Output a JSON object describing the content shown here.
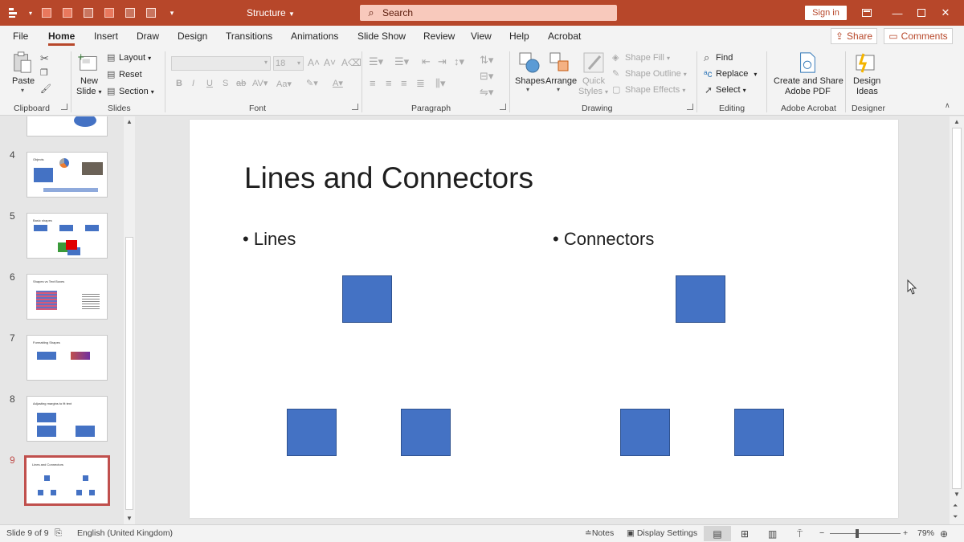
{
  "window": {
    "doc_title": "Structure",
    "search_placeholder": "Search",
    "sign_in": "Sign in"
  },
  "tabs": [
    "File",
    "Home",
    "Insert",
    "Draw",
    "Design",
    "Transitions",
    "Animations",
    "Slide Show",
    "Review",
    "View",
    "Help",
    "Acrobat"
  ],
  "active_tab": "Home",
  "actions": {
    "share": "Share",
    "comments": "Comments"
  },
  "ribbon": {
    "clipboard": {
      "paste": "Paste",
      "label": "Clipboard"
    },
    "slides": {
      "new_slide_1": "New",
      "new_slide_2": "Slide",
      "layout": "Layout",
      "reset": "Reset",
      "section": "Section",
      "label": "Slides"
    },
    "font": {
      "size": "18",
      "label": "Font"
    },
    "paragraph": {
      "label": "Paragraph"
    },
    "drawing": {
      "shapes": "Shapes",
      "arrange": "Arrange",
      "quick_styles_1": "Quick",
      "quick_styles_2": "Styles",
      "shape_fill": "Shape Fill",
      "shape_outline": "Shape Outline",
      "shape_effects": "Shape Effects",
      "label": "Drawing"
    },
    "editing": {
      "find": "Find",
      "replace": "Replace",
      "select": "Select",
      "label": "Editing"
    },
    "acrobat": {
      "create_1": "Create and Share",
      "create_2": "Adobe PDF",
      "label": "Adobe Acrobat"
    },
    "designer": {
      "ideas_1": "Design",
      "ideas_2": "Ideas",
      "label": "Designer"
    }
  },
  "thumbnails": [
    {
      "num": "4",
      "title": "Objects"
    },
    {
      "num": "5",
      "title": "Basic shapes"
    },
    {
      "num": "6",
      "title": "Shapes vs Text Boxes"
    },
    {
      "num": "7",
      "title": "Formatting Shapes"
    },
    {
      "num": "8",
      "title": "Adjusting margins to fit text"
    },
    {
      "num": "9",
      "title": "Lines and Connectors"
    }
  ],
  "slide": {
    "title": "Lines and Connectors",
    "bullet_left": "Lines",
    "bullet_right": "Connectors",
    "shape_color": "#4472C4"
  },
  "status": {
    "slide_of": "Slide 9 of 9",
    "language": "English (United Kingdom)",
    "notes": "Notes",
    "display_settings": "Display Settings",
    "zoom": "79%"
  },
  "colors": {
    "accent": "#B7472A",
    "selection": "#C0504D"
  }
}
